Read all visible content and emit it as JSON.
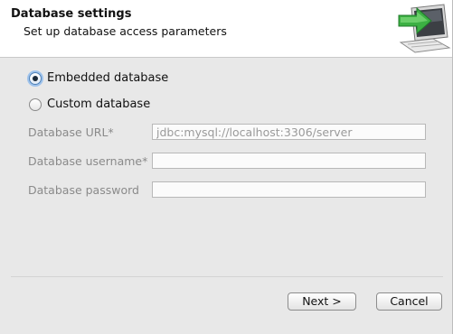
{
  "header": {
    "title": "Database settings",
    "subtitle": "Set up database access parameters",
    "graphic_icon": "computer-with-green-arrow-icon"
  },
  "database_type": {
    "selected": "embedded",
    "options": [
      {
        "id": "embedded",
        "label": "Embedded database",
        "checked": true
      },
      {
        "id": "custom",
        "label": "Custom database",
        "checked": false
      }
    ]
  },
  "fields": {
    "url": {
      "label": "Database URL*",
      "value": "jdbc:mysql://localhost:3306/server",
      "enabled": false
    },
    "username": {
      "label": "Database username*",
      "value": "",
      "enabled": false
    },
    "password": {
      "label": "Database password",
      "value": "",
      "enabled": false
    }
  },
  "buttons": {
    "next": "Next >",
    "cancel": "Cancel"
  },
  "colors": {
    "accent_focus": "#9fc3ec",
    "disabled_text": "#8a8a8a",
    "arrow_green": "#3cb043"
  }
}
